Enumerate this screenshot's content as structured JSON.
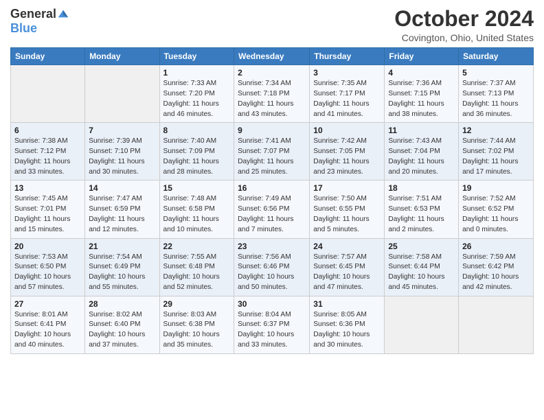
{
  "header": {
    "logo_general": "General",
    "logo_blue": "Blue",
    "month_title": "October 2024",
    "subtitle": "Covington, Ohio, United States"
  },
  "days_of_week": [
    "Sunday",
    "Monday",
    "Tuesday",
    "Wednesday",
    "Thursday",
    "Friday",
    "Saturday"
  ],
  "weeks": [
    [
      {
        "day": "",
        "info": ""
      },
      {
        "day": "",
        "info": ""
      },
      {
        "day": "1",
        "info": "Sunrise: 7:33 AM\nSunset: 7:20 PM\nDaylight: 11 hours and 46 minutes."
      },
      {
        "day": "2",
        "info": "Sunrise: 7:34 AM\nSunset: 7:18 PM\nDaylight: 11 hours and 43 minutes."
      },
      {
        "day": "3",
        "info": "Sunrise: 7:35 AM\nSunset: 7:17 PM\nDaylight: 11 hours and 41 minutes."
      },
      {
        "day": "4",
        "info": "Sunrise: 7:36 AM\nSunset: 7:15 PM\nDaylight: 11 hours and 38 minutes."
      },
      {
        "day": "5",
        "info": "Sunrise: 7:37 AM\nSunset: 7:13 PM\nDaylight: 11 hours and 36 minutes."
      }
    ],
    [
      {
        "day": "6",
        "info": "Sunrise: 7:38 AM\nSunset: 7:12 PM\nDaylight: 11 hours and 33 minutes."
      },
      {
        "day": "7",
        "info": "Sunrise: 7:39 AM\nSunset: 7:10 PM\nDaylight: 11 hours and 30 minutes."
      },
      {
        "day": "8",
        "info": "Sunrise: 7:40 AM\nSunset: 7:09 PM\nDaylight: 11 hours and 28 minutes."
      },
      {
        "day": "9",
        "info": "Sunrise: 7:41 AM\nSunset: 7:07 PM\nDaylight: 11 hours and 25 minutes."
      },
      {
        "day": "10",
        "info": "Sunrise: 7:42 AM\nSunset: 7:05 PM\nDaylight: 11 hours and 23 minutes."
      },
      {
        "day": "11",
        "info": "Sunrise: 7:43 AM\nSunset: 7:04 PM\nDaylight: 11 hours and 20 minutes."
      },
      {
        "day": "12",
        "info": "Sunrise: 7:44 AM\nSunset: 7:02 PM\nDaylight: 11 hours and 17 minutes."
      }
    ],
    [
      {
        "day": "13",
        "info": "Sunrise: 7:45 AM\nSunset: 7:01 PM\nDaylight: 11 hours and 15 minutes."
      },
      {
        "day": "14",
        "info": "Sunrise: 7:47 AM\nSunset: 6:59 PM\nDaylight: 11 hours and 12 minutes."
      },
      {
        "day": "15",
        "info": "Sunrise: 7:48 AM\nSunset: 6:58 PM\nDaylight: 11 hours and 10 minutes."
      },
      {
        "day": "16",
        "info": "Sunrise: 7:49 AM\nSunset: 6:56 PM\nDaylight: 11 hours and 7 minutes."
      },
      {
        "day": "17",
        "info": "Sunrise: 7:50 AM\nSunset: 6:55 PM\nDaylight: 11 hours and 5 minutes."
      },
      {
        "day": "18",
        "info": "Sunrise: 7:51 AM\nSunset: 6:53 PM\nDaylight: 11 hours and 2 minutes."
      },
      {
        "day": "19",
        "info": "Sunrise: 7:52 AM\nSunset: 6:52 PM\nDaylight: 11 hours and 0 minutes."
      }
    ],
    [
      {
        "day": "20",
        "info": "Sunrise: 7:53 AM\nSunset: 6:50 PM\nDaylight: 10 hours and 57 minutes."
      },
      {
        "day": "21",
        "info": "Sunrise: 7:54 AM\nSunset: 6:49 PM\nDaylight: 10 hours and 55 minutes."
      },
      {
        "day": "22",
        "info": "Sunrise: 7:55 AM\nSunset: 6:48 PM\nDaylight: 10 hours and 52 minutes."
      },
      {
        "day": "23",
        "info": "Sunrise: 7:56 AM\nSunset: 6:46 PM\nDaylight: 10 hours and 50 minutes."
      },
      {
        "day": "24",
        "info": "Sunrise: 7:57 AM\nSunset: 6:45 PM\nDaylight: 10 hours and 47 minutes."
      },
      {
        "day": "25",
        "info": "Sunrise: 7:58 AM\nSunset: 6:44 PM\nDaylight: 10 hours and 45 minutes."
      },
      {
        "day": "26",
        "info": "Sunrise: 7:59 AM\nSunset: 6:42 PM\nDaylight: 10 hours and 42 minutes."
      }
    ],
    [
      {
        "day": "27",
        "info": "Sunrise: 8:01 AM\nSunset: 6:41 PM\nDaylight: 10 hours and 40 minutes."
      },
      {
        "day": "28",
        "info": "Sunrise: 8:02 AM\nSunset: 6:40 PM\nDaylight: 10 hours and 37 minutes."
      },
      {
        "day": "29",
        "info": "Sunrise: 8:03 AM\nSunset: 6:38 PM\nDaylight: 10 hours and 35 minutes."
      },
      {
        "day": "30",
        "info": "Sunrise: 8:04 AM\nSunset: 6:37 PM\nDaylight: 10 hours and 33 minutes."
      },
      {
        "day": "31",
        "info": "Sunrise: 8:05 AM\nSunset: 6:36 PM\nDaylight: 10 hours and 30 minutes."
      },
      {
        "day": "",
        "info": ""
      },
      {
        "day": "",
        "info": ""
      }
    ]
  ]
}
